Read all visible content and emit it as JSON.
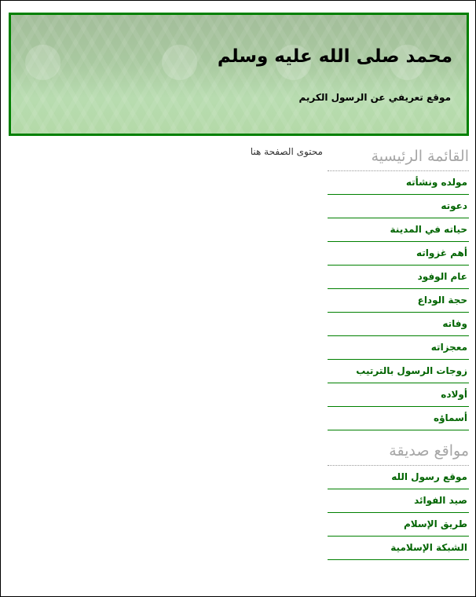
{
  "header": {
    "title": "محمد صلى الله عليه وسلم",
    "subtitle": "موقع تعريفي عن الرسول الكريم"
  },
  "content": {
    "placeholder": "محتوى الصفحة هنا"
  },
  "sidebar": {
    "main_menu": {
      "title": "القائمة الرئيسية",
      "items": [
        {
          "label": "مولده ونشأته"
        },
        {
          "label": "دعوته"
        },
        {
          "label": "حياته في المدينة"
        },
        {
          "label": "أهم غزواته"
        },
        {
          "label": "عام الوفود"
        },
        {
          "label": "حجة الوداع"
        },
        {
          "label": "وفاته"
        },
        {
          "label": "معجزاته"
        },
        {
          "label": "زوجات الرسول بالترتيب"
        },
        {
          "label": "أولاده"
        },
        {
          "label": "أسماؤه"
        }
      ]
    },
    "friend_sites": {
      "title": "مواقع صديقة",
      "items": [
        {
          "label": "موقع رسول الله"
        },
        {
          "label": "صيد الفوائد"
        },
        {
          "label": "طريق الإسلام"
        },
        {
          "label": "الشبكة الإسلامية"
        }
      ]
    }
  },
  "colors": {
    "accent": "#008000",
    "link": "#006400",
    "section_title": "#a6a6a6"
  }
}
